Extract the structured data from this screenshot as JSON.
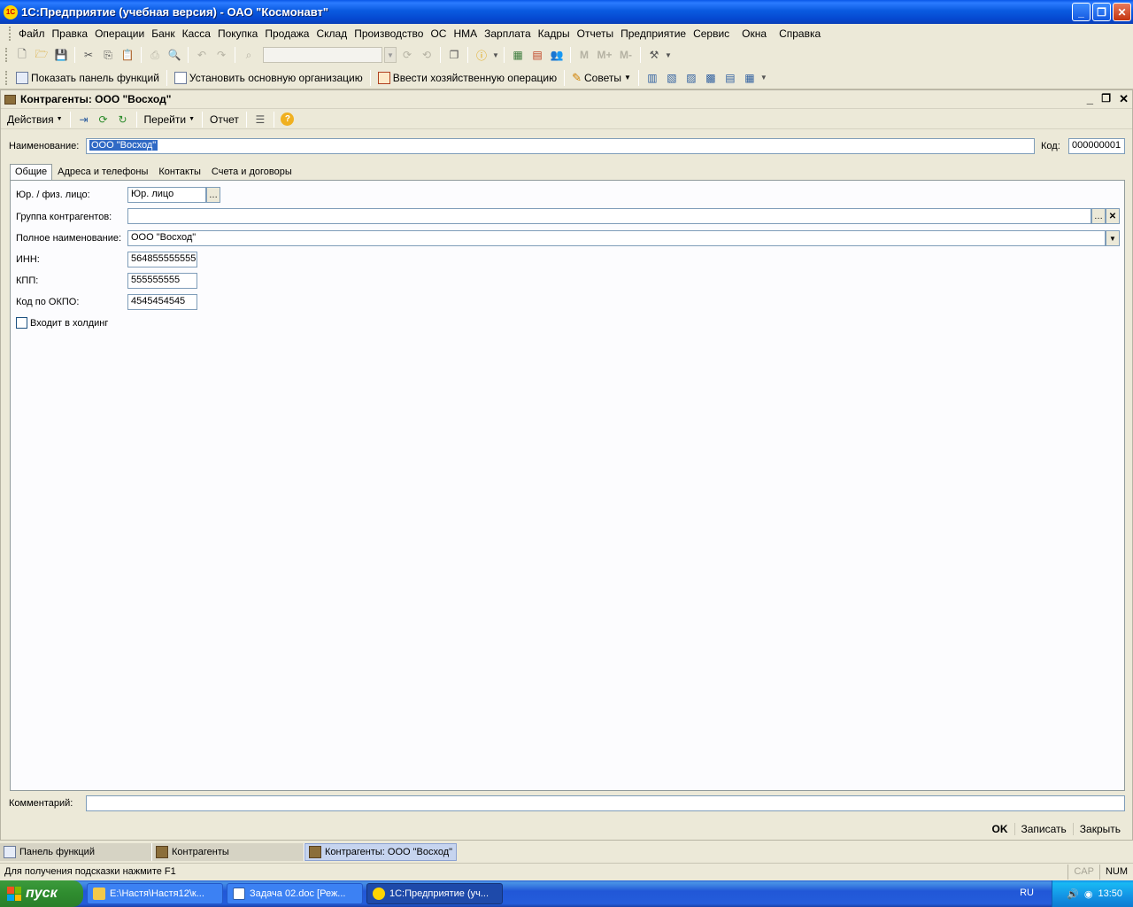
{
  "window": {
    "title": "1С:Предприятие (учебная версия) - ОАО \"Космонавт\"",
    "logo": "1C"
  },
  "menubar": {
    "items": [
      "Файл",
      "Правка",
      "Операции",
      "Банк",
      "Касса",
      "Покупка",
      "Продажа",
      "Склад",
      "Производство",
      "ОС",
      "НМА",
      "Зарплата",
      "Кадры",
      "Отчеты",
      "Предприятие",
      "Сервис",
      "Окна",
      "Справка"
    ]
  },
  "toolbar2": {
    "show_panel": "Показать панель функций",
    "set_org": "Установить основную организацию",
    "enter_op": "Ввести хозяйственную операцию",
    "tips": "Советы"
  },
  "doc": {
    "title": "Контрагенты: ООО \"Восход\"",
    "toolbar": {
      "actions": "Действия",
      "goto": "Перейти",
      "report": "Отчет"
    },
    "name_label": "Наименование:",
    "name_value": "ООО \"Восход\"",
    "code_label": "Код:",
    "code_value": "000000001",
    "tabs": [
      "Общие",
      "Адреса и телефоны",
      "Контакты",
      "Счета и договоры"
    ],
    "fields": {
      "entity_type_label": "Юр. / физ. лицо:",
      "entity_type_value": "Юр. лицо",
      "group_label": "Группа контрагентов:",
      "group_value": "",
      "full_name_label": "Полное наименование:",
      "full_name_value": "ООО \"Восход\"",
      "inn_label": "ИНН:",
      "inn_value": "564855555555",
      "kpp_label": "КПП:",
      "kpp_value": "555555555",
      "okpo_label": "Код по ОКПО:",
      "okpo_value": "4545454545",
      "holding_label": "Входит в холдинг",
      "holding_checked": false
    },
    "comment_label": "Комментарий:",
    "comment_value": "",
    "buttons": {
      "ok": "OK",
      "save": "Записать",
      "close": "Закрыть"
    }
  },
  "window_tabs": [
    "Панель функций",
    "Контрагенты",
    "Контрагенты: ООО \"Восход\""
  ],
  "status": {
    "hint": "Для получения подсказки нажмите F1",
    "cap": "CAP",
    "num": "NUM"
  },
  "taskbar": {
    "start": "пуск",
    "tasks": [
      "E:\\Настя\\Настя12\\к...",
      "Задача 02.doc [Реж...",
      "1С:Предприятие (уч..."
    ],
    "lang": "RU",
    "clock": "13:50"
  }
}
